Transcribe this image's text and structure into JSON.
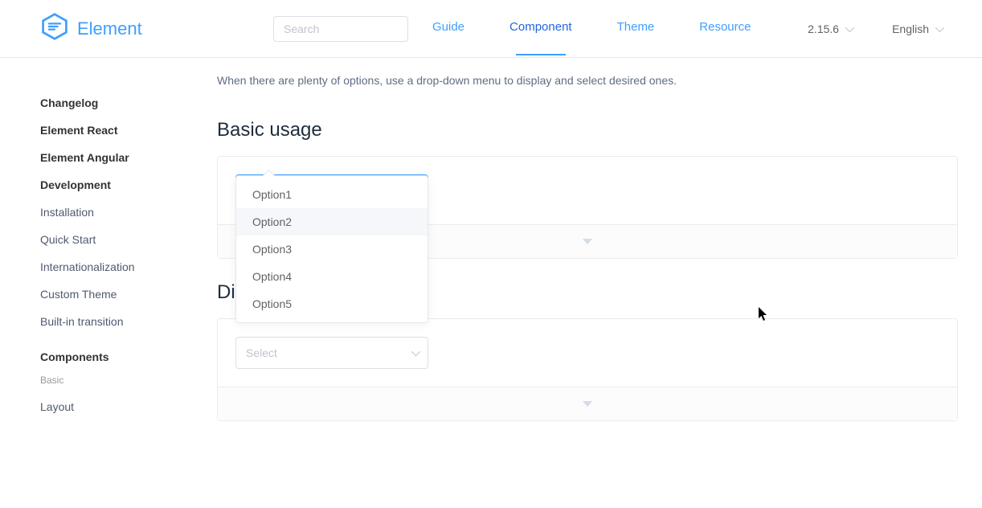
{
  "brand": "Element",
  "search_placeholder": "Search",
  "nav": {
    "guide": "Guide",
    "component": "Component",
    "theme": "Theme",
    "resource": "Resource"
  },
  "version": "2.15.6",
  "language": "English",
  "sidebar": {
    "changelog": "Changelog",
    "element_react": "Element React",
    "element_angular": "Element Angular",
    "development": "Development",
    "dev_items": {
      "installation": "Installation",
      "quick_start": "Quick Start",
      "i18n": "Internationalization",
      "custom_theme": "Custom Theme",
      "transition": "Built-in transition"
    },
    "components_hdr": "Components",
    "basic_cat": "Basic",
    "layout": "Layout"
  },
  "intro": "When there are plenty of options, use a drop-down menu to display and select desired ones.",
  "sections": {
    "basic_usage": "Basic usage",
    "disabled": "Dis"
  },
  "select_placeholder": "Select",
  "options": [
    "Option1",
    "Option2",
    "Option3",
    "Option4",
    "Option5"
  ]
}
